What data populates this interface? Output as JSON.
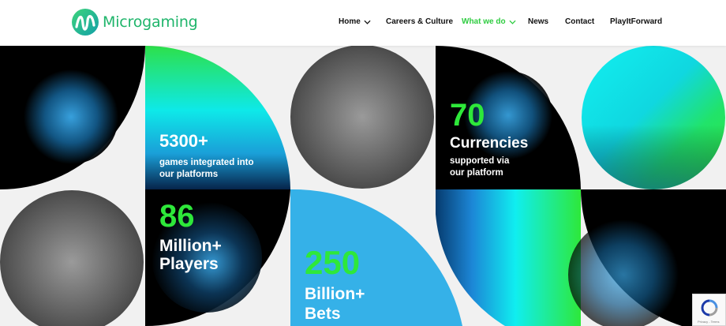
{
  "brand": {
    "name": "Microgaming"
  },
  "nav": {
    "items": [
      {
        "label": "Home",
        "has_dropdown": true,
        "active": false
      },
      {
        "label": "Careers & Culture",
        "has_dropdown": false,
        "active": false
      },
      {
        "label": "What we do",
        "has_dropdown": true,
        "active": true
      },
      {
        "label": "News",
        "has_dropdown": false,
        "active": false
      },
      {
        "label": "Contact",
        "has_dropdown": false,
        "active": false
      },
      {
        "label": "PlayItForward",
        "has_dropdown": false,
        "active": false
      }
    ]
  },
  "stats": {
    "games": {
      "number": "5300+",
      "line1": "games integrated into",
      "line2": "our platforms"
    },
    "currencies": {
      "number": "70",
      "title": "Currencies",
      "line1": "supported via",
      "line2": "our platform"
    },
    "players": {
      "number": "86",
      "line1": "Million+",
      "line2": "Players"
    },
    "bets": {
      "number": "250",
      "line1": "Billion+",
      "line2": "Bets"
    }
  },
  "recaptcha": {
    "links": "Privacy - Terms"
  },
  "colors": {
    "brand_green": "#1fb56b",
    "active_nav": "#2ecc40",
    "stat_green": "#2ee83a",
    "sky_blue": "#35b1e8"
  }
}
